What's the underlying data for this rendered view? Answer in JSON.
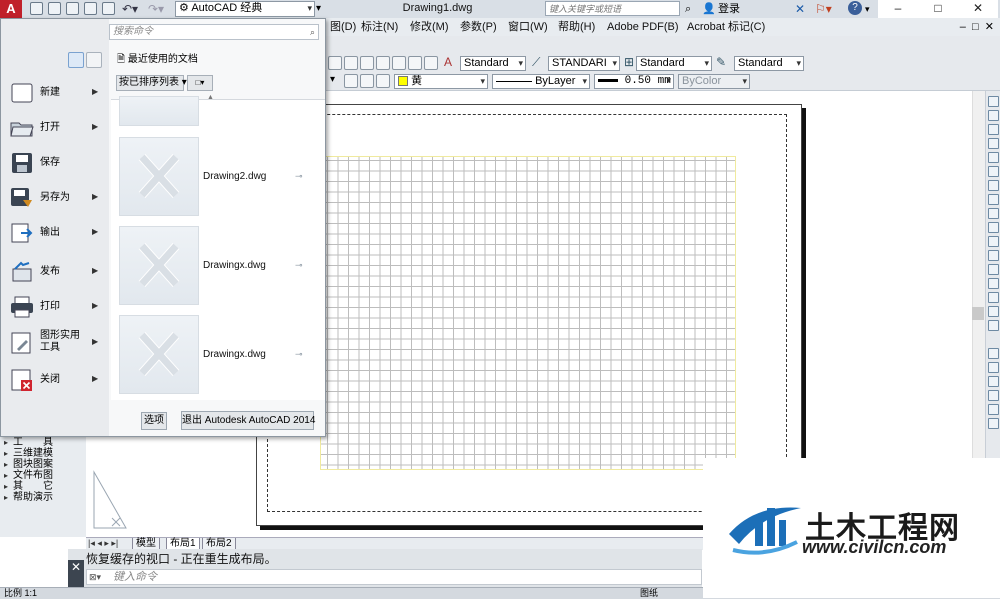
{
  "titlebar": {
    "workspace": "AutoCAD 经典",
    "title": "Drawing1.dwg",
    "search_placeholder": "键入关键字或短语",
    "login": "登录"
  },
  "menubar": {
    "items": [
      "图(D)",
      "标注(N)",
      "修改(M)",
      "参数(P)",
      "窗口(W)",
      "帮助(H)",
      "Adobe PDF(B)",
      "Acrobat 标记(C)"
    ]
  },
  "toolbar2": {
    "text_style": "Standard",
    "dim_style": "STANDARI",
    "table_style": "Standard",
    "multileader_style": "Standard"
  },
  "toolbar3": {
    "color": "黄",
    "linetype": "ByLayer",
    "lineweight": "0.50 mm",
    "plotstyle": "ByColor"
  },
  "app_menu": {
    "search_placeholder": "搜索命令",
    "recent_header": "最近使用的文档",
    "sort_label": "按已排序列表",
    "items": [
      {
        "label": "新建",
        "icon": "new-document-icon"
      },
      {
        "label": "打开",
        "icon": "open-folder-icon"
      },
      {
        "label": "保存",
        "icon": "save-disk-icon"
      },
      {
        "label": "另存为",
        "icon": "save-as-icon"
      },
      {
        "label": "输出",
        "icon": "export-icon"
      },
      {
        "label": "发布",
        "icon": "publish-icon"
      },
      {
        "label": "打印",
        "icon": "print-icon"
      },
      {
        "label": "图形实用工具",
        "label_line1": "图形实用",
        "label_line2": "工具",
        "icon": "drawing-utilities-icon"
      },
      {
        "label": "关闭",
        "icon": "close-drawing-icon"
      }
    ],
    "recent_files": [
      "Drawing2.dwg",
      "Drawingx.dwg",
      "Drawingx.dwg"
    ],
    "options_label": "选项",
    "exit_label": "退出 Autodesk AutoCAD 2014"
  },
  "palette_tree": {
    "items": [
      "工　　具",
      "三维建模",
      "图块图案",
      "文件布图",
      "其　　它",
      "帮助演示"
    ]
  },
  "layout_tabs": [
    "模型",
    "布局1",
    "布局2"
  ],
  "command": {
    "history": "恢复缓存的视口 - 正在重生成布局。",
    "input_placeholder": "键入命令"
  },
  "statusbar": {
    "scale": "比例 1:1",
    "mode": "图纸"
  },
  "watermark": {
    "title": "土木工程网",
    "url": "www.civilcn.com"
  },
  "colors": {
    "accent_red": "#c0202a",
    "watermark_blue": "#1c6fb8",
    "grid_line": "#bdbdbd",
    "grid_border": "#f0ea9e"
  }
}
